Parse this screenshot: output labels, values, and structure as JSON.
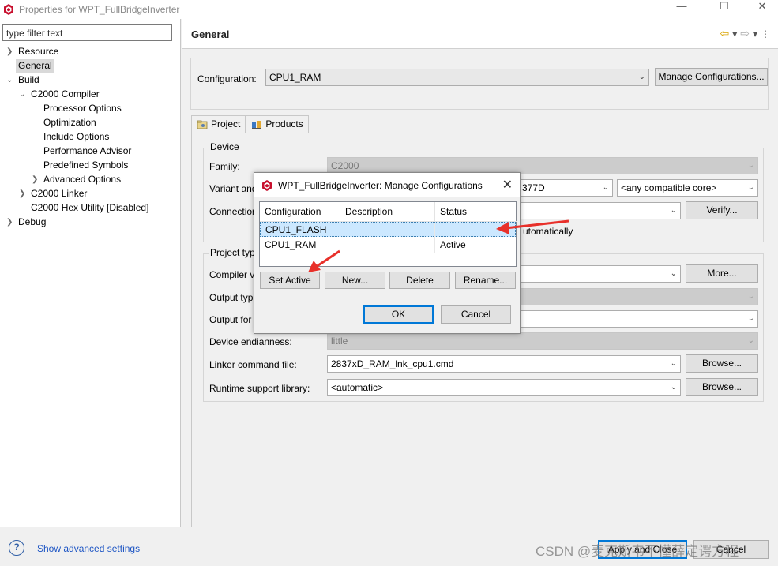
{
  "window": {
    "title": "Properties for WPT_FullBridgeInverter",
    "minimize": "—",
    "maximize": "☐",
    "close": "✕"
  },
  "filter": {
    "placeholder": "type filter text"
  },
  "tree": {
    "resource": "Resource",
    "general": "General",
    "build": "Build",
    "c2000_compiler": "C2000 Compiler",
    "processor_options": "Processor Options",
    "optimization": "Optimization",
    "include_options": "Include Options",
    "performance_advisor": "Performance Advisor",
    "predefined_symbols": "Predefined Symbols",
    "advanced_options": "Advanced Options",
    "c2000_linker": "C2000 Linker",
    "c2000_hex_utility": "C2000 Hex Utility  [Disabled]",
    "debug": "Debug"
  },
  "header": {
    "title": "General"
  },
  "configuration": {
    "label": "Configuration:",
    "value": "CPU1_RAM",
    "manage_button": "Manage Configurations..."
  },
  "tabs": {
    "project": "Project",
    "products": "Products"
  },
  "device": {
    "group_title": "Device",
    "family_label": "Family:",
    "family_value": "C2000",
    "variant_label": "Variant and",
    "variant_value": "377D",
    "core_value": "<any compatible core>",
    "connection_label": "Connection",
    "verify_button": "Verify...",
    "auto_text": "utomatically"
  },
  "project_type": {
    "group_title": "Project typ",
    "compiler_label": "Compiler v",
    "more_button": "More...",
    "output_type_label": "Output typ",
    "output_format_label": "Output for",
    "endianness_label": "Device endianness:",
    "endianness_value": "little",
    "linker_label": "Linker command file:",
    "linker_value": "2837xD_RAM_lnk_cpu1.cmd",
    "runtime_label": "Runtime support library:",
    "runtime_value": "<automatic>",
    "browse_button": "Browse..."
  },
  "bottom": {
    "help": "?",
    "advanced_link": "Show advanced settings",
    "apply_close": "Apply and Close",
    "cancel": "Cancel",
    "watermark": "CSDN @麦克斯韦不懂薛定谔方程"
  },
  "dialog": {
    "title": "WPT_FullBridgeInverter: Manage Configurations",
    "close": "✕",
    "columns": [
      "Configuration",
      "Description",
      "Status"
    ],
    "rows": [
      {
        "configuration": "CPU1_FLASH",
        "description": "",
        "status": ""
      },
      {
        "configuration": "CPU1_RAM",
        "description": "",
        "status": "Active"
      }
    ],
    "set_active": "Set Active",
    "new": "New...",
    "delete": "Delete",
    "rename": "Rename...",
    "ok": "OK",
    "cancel": "Cancel"
  },
  "colors": {
    "accent": "#0078d7",
    "selection": "#cce8ff",
    "link": "#1d55c4",
    "annotation_arrow": "#e8302a"
  }
}
